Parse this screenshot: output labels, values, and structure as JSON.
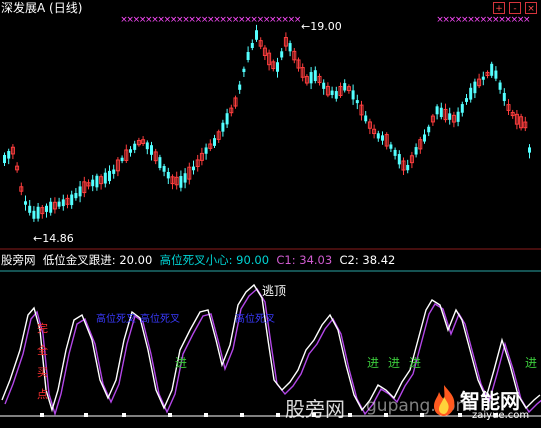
{
  "window": {
    "title": "深发展A (日线)",
    "controls": [
      "+",
      "-",
      "×"
    ]
  },
  "price_chart": {
    "high_label": "19.00",
    "low_label": "14.86",
    "high_arrow": "←",
    "low_arrow": "←"
  },
  "indicator_bar": {
    "name": "股旁网",
    "p1_label": "低位金叉跟进:",
    "p1_value": "20.00",
    "p2_label": "高位死叉小心:",
    "p2_value": "90.00",
    "c1_label": "C1:",
    "c1_value": "34.03",
    "c2_label": "C2:",
    "c2_value": "38.42"
  },
  "sub_chart": {
    "top_label": "逃顶",
    "left_vertical_label": [
      "完",
      "全",
      "买",
      "点"
    ],
    "blue_labels": [
      "高位死叉",
      "高位死叉",
      "高位死叉"
    ],
    "green_labels": [
      "进",
      "进",
      "进",
      "进",
      "进"
    ]
  },
  "watermarks": {
    "site_cn": "股旁网",
    "site_url": "gupang.com",
    "logo_cn": "智能网",
    "logo_url": "zaiyue.com"
  },
  "colors": {
    "bg": "#000000",
    "up": "#ff3e3e",
    "down": "#54ffff",
    "text_white": "#ffffff",
    "p1": "#ffffff",
    "p2": "#00d4d4",
    "c1": "#d05cd0",
    "c2": "#ffffff",
    "line_c1": "#b347e8",
    "line_c2": "#ffffff",
    "magenta_mark": "#ff4cff",
    "blue_label": "#3a3aff",
    "green_label": "#3ccc3c",
    "red_label": "#ff3030"
  }
}
